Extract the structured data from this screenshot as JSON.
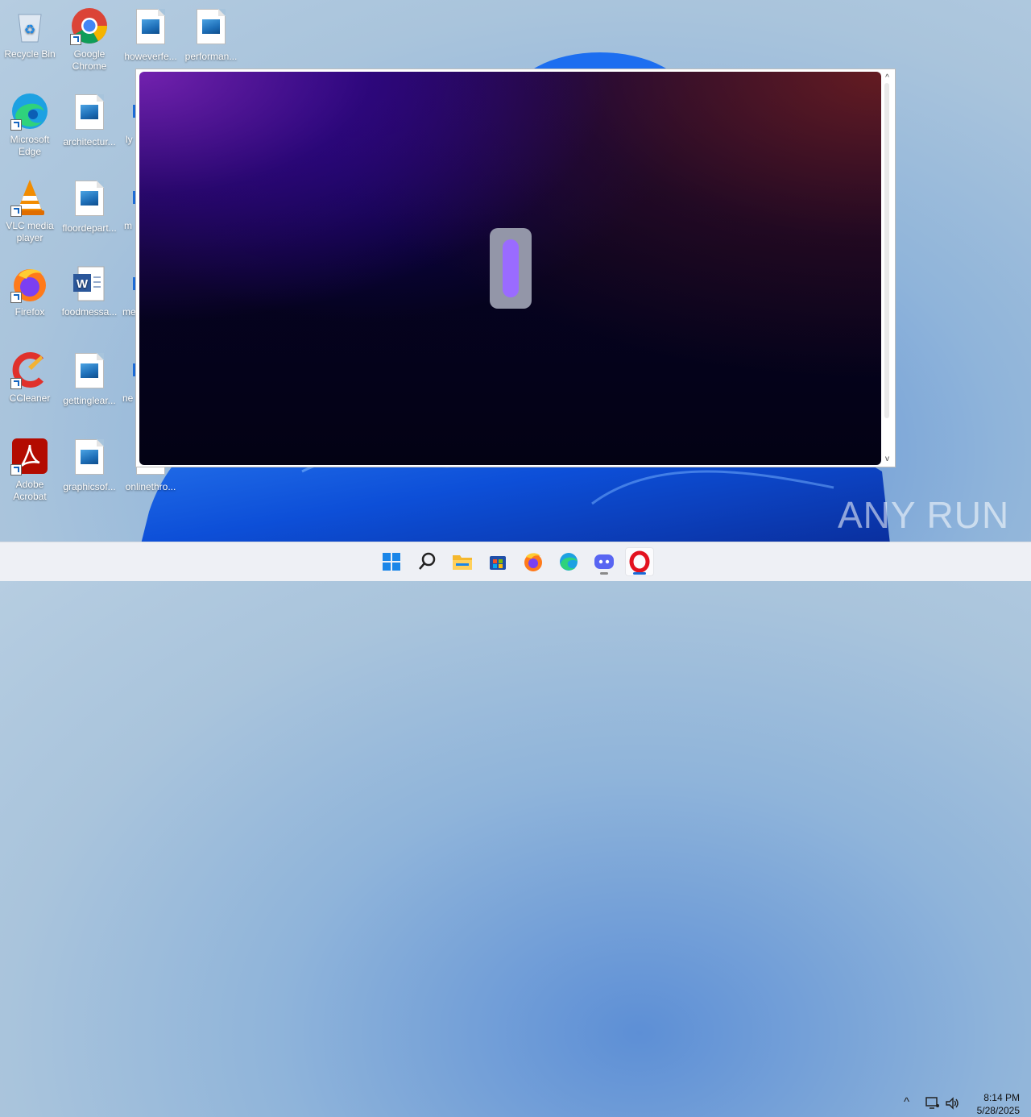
{
  "desktop": {
    "icons": [
      {
        "label": "Recycle Bin",
        "icon": "recycle-bin-icon"
      },
      {
        "label": "Google Chrome",
        "icon": "chrome-icon"
      },
      {
        "label": "howeverfe...",
        "icon": "image-file-icon"
      },
      {
        "label": "performan...",
        "icon": "image-file-icon"
      },
      {
        "label": "Microsoft Edge",
        "icon": "edge-icon"
      },
      {
        "label": "architectur...",
        "icon": "image-file-icon"
      },
      {
        "label": "VLC media player",
        "icon": "vlc-icon"
      },
      {
        "label": "floordepart...",
        "icon": "image-file-icon"
      },
      {
        "label": "Firefox",
        "icon": "firefox-icon"
      },
      {
        "label": "foodmessa...",
        "icon": "word-doc-icon"
      },
      {
        "label": "CCleaner",
        "icon": "ccleaner-icon"
      },
      {
        "label": "gettinglear...",
        "icon": "image-file-icon"
      },
      {
        "label": "Adobe Acrobat",
        "icon": "acrobat-icon"
      },
      {
        "label": "graphicsof...",
        "icon": "image-file-icon"
      },
      {
        "label": "onlinethro...",
        "icon": "image-file-icon"
      }
    ],
    "partial_labels": [
      "ly",
      "m",
      "me",
      "ne"
    ]
  },
  "window": {
    "loader": "progress-loader"
  },
  "watermark": "ANY RUN",
  "taskbar": {
    "apps": [
      "start-icon",
      "search-icon",
      "file-explorer-icon",
      "store-icon",
      "firefox-icon",
      "edge-icon",
      "discord-icon",
      "opera-icon"
    ],
    "active_app": "opera-icon"
  },
  "clock": {
    "time": "8:14 PM",
    "date": "5/28/2025"
  },
  "colors": {
    "accent": "#1a6ad6",
    "loader_fill": "#9a6bff"
  }
}
